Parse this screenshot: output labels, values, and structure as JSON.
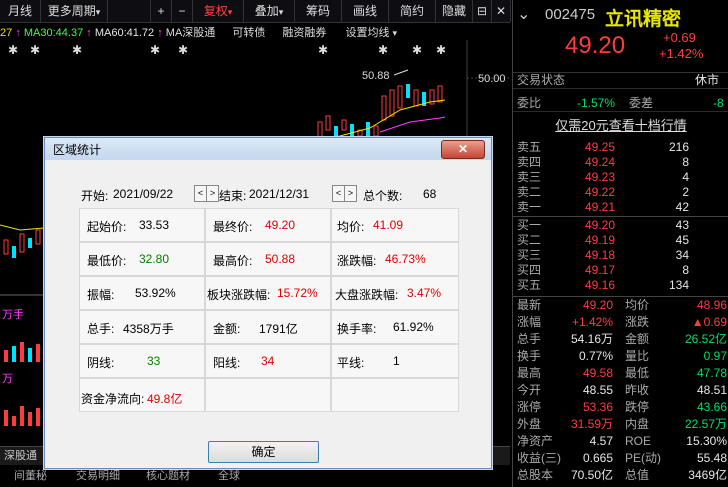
{
  "toolbar": {
    "items": [
      "月线",
      "更多周期",
      "+",
      "−",
      "复权",
      "叠加",
      "筹码",
      "画线",
      "简约",
      "隐藏"
    ],
    "more_arrow": "▾",
    "fq_arrow": "▾",
    "overlay_arrow": "▾",
    "tool_icons": [
      "⊟",
      "✕"
    ]
  },
  "ma_row": {
    "ma20_tail": "27",
    "ma30": "MA30:44.37",
    "ma60": "MA60:41.72",
    "deep": "MA深股通",
    "convertible": "可转债",
    "margin": "融资融券",
    "settings": "设置均线"
  },
  "chart": {
    "price_label_high": "50.88",
    "axis_label": "50.00",
    "wan": "万手",
    "wan2": "万"
  },
  "bottom_tabs": [
    "深股通",
    "间董秘",
    "交易明细",
    "核心题材",
    "全球"
  ],
  "right_panel": {
    "code": "002475",
    "name": "立讯精密",
    "price": "49.20",
    "change": "+0.69",
    "change_pct": "+1.42%",
    "status_label": "交易状态",
    "status_value": "休市",
    "weibi_label": "委比",
    "weibi_value": "-1.57%",
    "weicha_label": "委差",
    "weicha_value": "-8",
    "promo": "仅需20元查看十档行情",
    "asks": [
      {
        "label": "卖五",
        "price": "49.25",
        "vol": "216"
      },
      {
        "label": "卖四",
        "price": "49.24",
        "vol": "8"
      },
      {
        "label": "卖三",
        "price": "49.23",
        "vol": "4"
      },
      {
        "label": "卖二",
        "price": "49.22",
        "vol": "2"
      },
      {
        "label": "卖一",
        "price": "49.21",
        "vol": "42"
      }
    ],
    "bids": [
      {
        "label": "买一",
        "price": "49.20",
        "vol": "43"
      },
      {
        "label": "买二",
        "price": "49.19",
        "vol": "45"
      },
      {
        "label": "买三",
        "price": "49.18",
        "vol": "34"
      },
      {
        "label": "买四",
        "price": "49.17",
        "vol": "8"
      },
      {
        "label": "买五",
        "price": "49.16",
        "vol": "134"
      }
    ],
    "stats": [
      {
        "l1": "最新",
        "v1": "49.20",
        "c1": "red",
        "l2": "均价",
        "v2": "48.96",
        "c2": "red"
      },
      {
        "l1": "涨幅",
        "v1": "+1.42%",
        "c1": "red",
        "l2": "涨跌",
        "v2": "▲0.69",
        "c2": "red"
      },
      {
        "l1": "总手",
        "v1": "54.16万",
        "c1": "white",
        "l2": "金额",
        "v2": "26.52亿",
        "c2": "green"
      },
      {
        "l1": "换手",
        "v1": "0.77%",
        "c1": "white",
        "l2": "量比",
        "v2": "0.97",
        "c2": "green"
      },
      {
        "l1": "最高",
        "v1": "49.58",
        "c1": "red",
        "l2": "最低",
        "v2": "47.78",
        "c2": "green"
      },
      {
        "l1": "今开",
        "v1": "48.55",
        "c1": "white",
        "l2": "昨收",
        "v2": "48.51",
        "c2": "white"
      },
      {
        "l1": "涨停",
        "v1": "53.36",
        "c1": "red",
        "l2": "跌停",
        "v2": "43.66",
        "c2": "green"
      },
      {
        "l1": "外盘",
        "v1": "31.59万",
        "c1": "red",
        "l2": "内盘",
        "v2": "22.57万",
        "c2": "green"
      },
      {
        "l1": "净资产",
        "v1": "4.57",
        "c1": "white",
        "l2": "ROE",
        "v2": "15.30%",
        "c2": "white"
      },
      {
        "l1": "收益(三)",
        "v1": "0.665",
        "c1": "white",
        "l2": "PE(动)",
        "v2": "55.48",
        "c2": "white"
      },
      {
        "l1": "总股本",
        "v1": "70.50亿",
        "c1": "white",
        "l2": "总值",
        "v2": "3469亿",
        "c2": "white"
      }
    ]
  },
  "dialog": {
    "title": "区域统计",
    "close": "✕",
    "start_label": "开始:",
    "start_date": "2021/09/22",
    "end_label": "结束:",
    "end_date": "2021/12/31",
    "count_label": "总个数:",
    "count_value": "68",
    "arrow_left": "<",
    "arrow_right": ">",
    "cells": {
      "start_price_label": "起始价:",
      "start_price": "33.53",
      "end_price_label": "最终价:",
      "end_price": "49.20",
      "avg_label": "均价:",
      "avg": "41.09",
      "low_label": "最低价:",
      "low": "32.80",
      "high_label": "最高价:",
      "high": "50.88",
      "pct_label": "涨跌幅:",
      "pct": "46.73%",
      "amp_label": "振幅:",
      "amp": "53.92%",
      "sector_label": "板块涨跌幅:",
      "sector": "15.72%",
      "market_label": "大盘涨跌幅:",
      "market": "3.47%",
      "vol_label": "总手:",
      "vol": "4358万手",
      "amount_label": "金额:",
      "amount": "1791亿",
      "turnover_label": "换手率:",
      "turnover": "61.92%",
      "neg_label": "阴线:",
      "neg": "33",
      "pos_label": "阳线:",
      "pos": "34",
      "flat_label": "平线:",
      "flat": "1",
      "flow_label": "资金净流向:",
      "flow": "49.8亿"
    },
    "ok": "确定"
  }
}
